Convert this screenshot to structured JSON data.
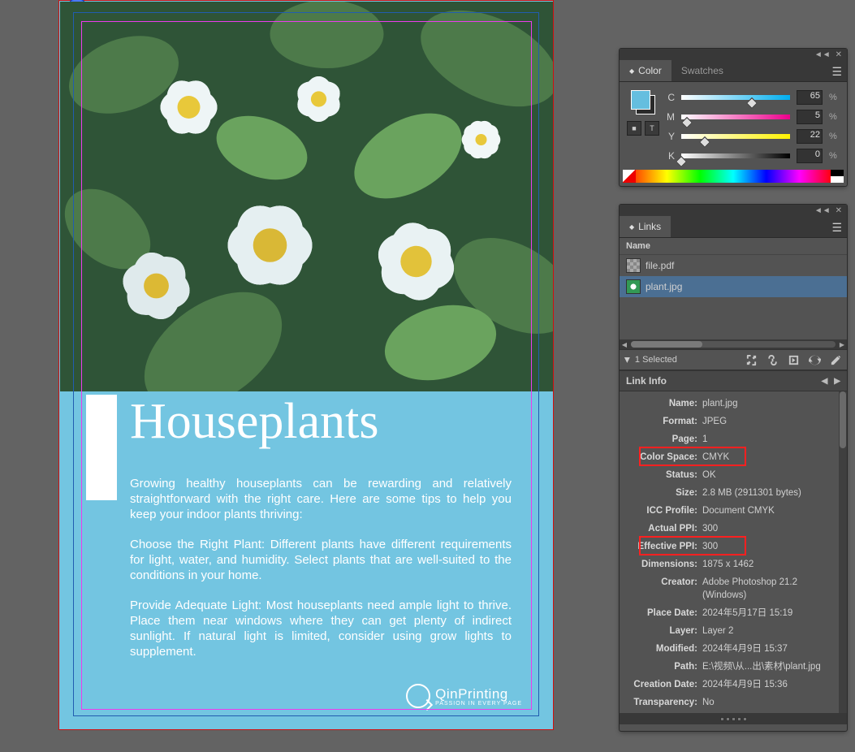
{
  "document": {
    "title": "Houseplants",
    "paragraphs": [
      "Growing healthy houseplants can be rewarding and relatively straightforward with the right care. Here are some tips to help you keep your indoor plants thriving:",
      "Choose the Right Plant: Different plants have different requirements for light, water, and humidity. Select plants that are well-suited to the conditions in your home.",
      "Provide Adequate Light: Most houseplants need ample light to thrive. Place them near windows where they can get plenty of indirect sunlight. If natural light is limited, consider using grow lights to supplement."
    ],
    "brand": {
      "name": "QinPrinting",
      "tagline": "PASSION IN EVERY PAGE"
    }
  },
  "color_panel": {
    "tabs": [
      "Color",
      "Swatches"
    ],
    "active_tab": "Color",
    "channels": [
      {
        "label": "C",
        "value": "65",
        "unit": "%",
        "grad": "gC"
      },
      {
        "label": "M",
        "value": "5",
        "unit": "%",
        "grad": "gM"
      },
      {
        "label": "Y",
        "value": "22",
        "unit": "%",
        "grad": "gY"
      },
      {
        "label": "K",
        "value": "0",
        "unit": "%",
        "grad": "gK"
      }
    ]
  },
  "links_panel": {
    "tab": "Links",
    "column_header": "Name",
    "items": [
      {
        "name": "file.pdf",
        "selected": false
      },
      {
        "name": "plant.jpg",
        "selected": true
      }
    ],
    "selected_text": "1 Selected",
    "info_header": "Link Info",
    "info": [
      {
        "label": "Name:",
        "value": "plant.jpg"
      },
      {
        "label": "Format:",
        "value": "JPEG"
      },
      {
        "label": "Page:",
        "value": "1"
      },
      {
        "label": "Color Space:",
        "value": "CMYK",
        "hl": true
      },
      {
        "label": "Status:",
        "value": "OK"
      },
      {
        "label": "Size:",
        "value": "2.8 MB (2911301 bytes)"
      },
      {
        "label": "ICC Profile:",
        "value": "Document CMYK"
      },
      {
        "label": "Actual PPI:",
        "value": "300"
      },
      {
        "label": "Effective PPI:",
        "value": "300",
        "hl": true
      },
      {
        "label": "Dimensions:",
        "value": "1875 x 1462"
      },
      {
        "label": "Creator:",
        "value": "Adobe Photoshop 21.2 (Windows)"
      },
      {
        "label": "Place Date:",
        "value": "2024年5月17日 15:19"
      },
      {
        "label": "Layer:",
        "value": "Layer 2"
      },
      {
        "label": "Modified:",
        "value": "2024年4月9日 15:37"
      },
      {
        "label": "Path:",
        "value": "E:\\视频\\从...出\\素材\\plant.jpg"
      },
      {
        "label": "Creation Date:",
        "value": "2024年4月9日 15:36"
      },
      {
        "label": "Transparency:",
        "value": "No"
      }
    ]
  }
}
